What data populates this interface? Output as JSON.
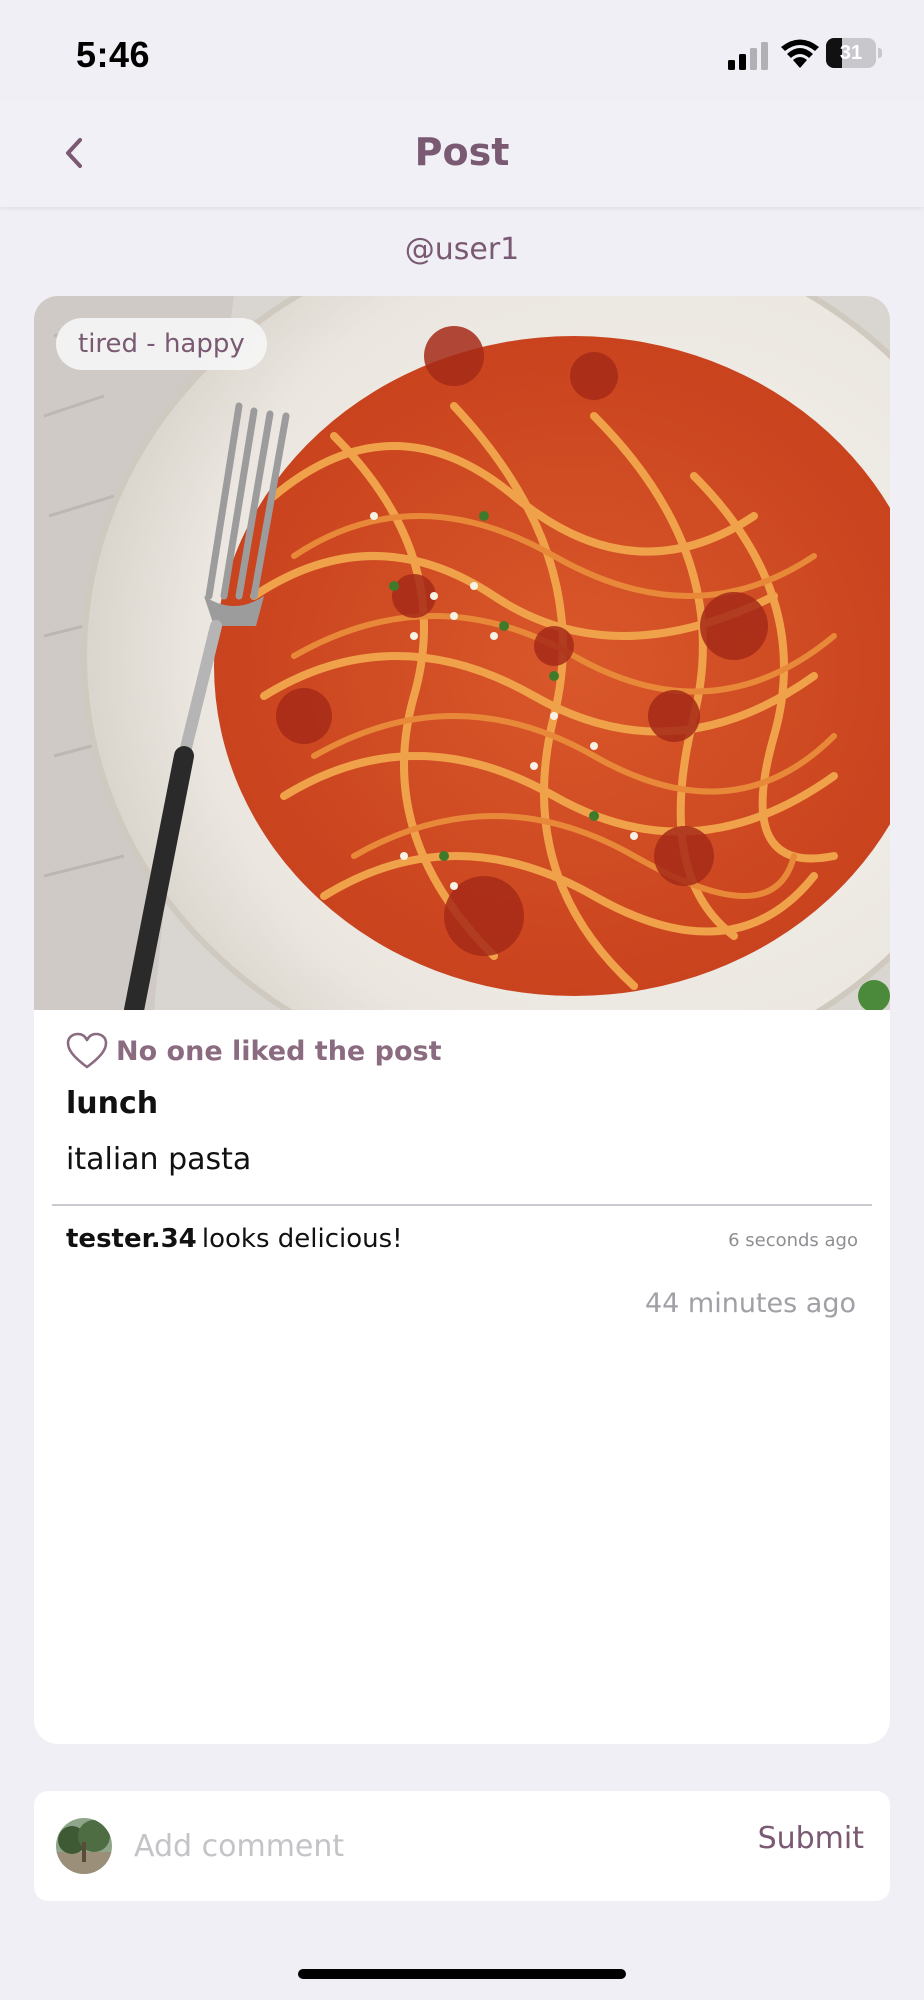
{
  "status_bar": {
    "time": "5:46",
    "battery_level": "31",
    "battery_fraction": 0.31
  },
  "nav": {
    "title": "Post",
    "back_icon": "chevron-left-icon"
  },
  "post": {
    "username": "@user1",
    "mood_tag": "tired - happy",
    "likes_text": "No one liked the post",
    "title": "lunch",
    "description": "italian pasta",
    "posted_time": "44 minutes ago"
  },
  "comments": [
    {
      "user": "tester.34",
      "text": "looks delicious!",
      "time": "6 seconds ago"
    }
  ],
  "comment_bar": {
    "placeholder": "Add comment",
    "submit_label": "Submit"
  },
  "colors": {
    "accent": "#7a5a72",
    "background": "#f0eff5",
    "muted": "#a0a0a6"
  }
}
